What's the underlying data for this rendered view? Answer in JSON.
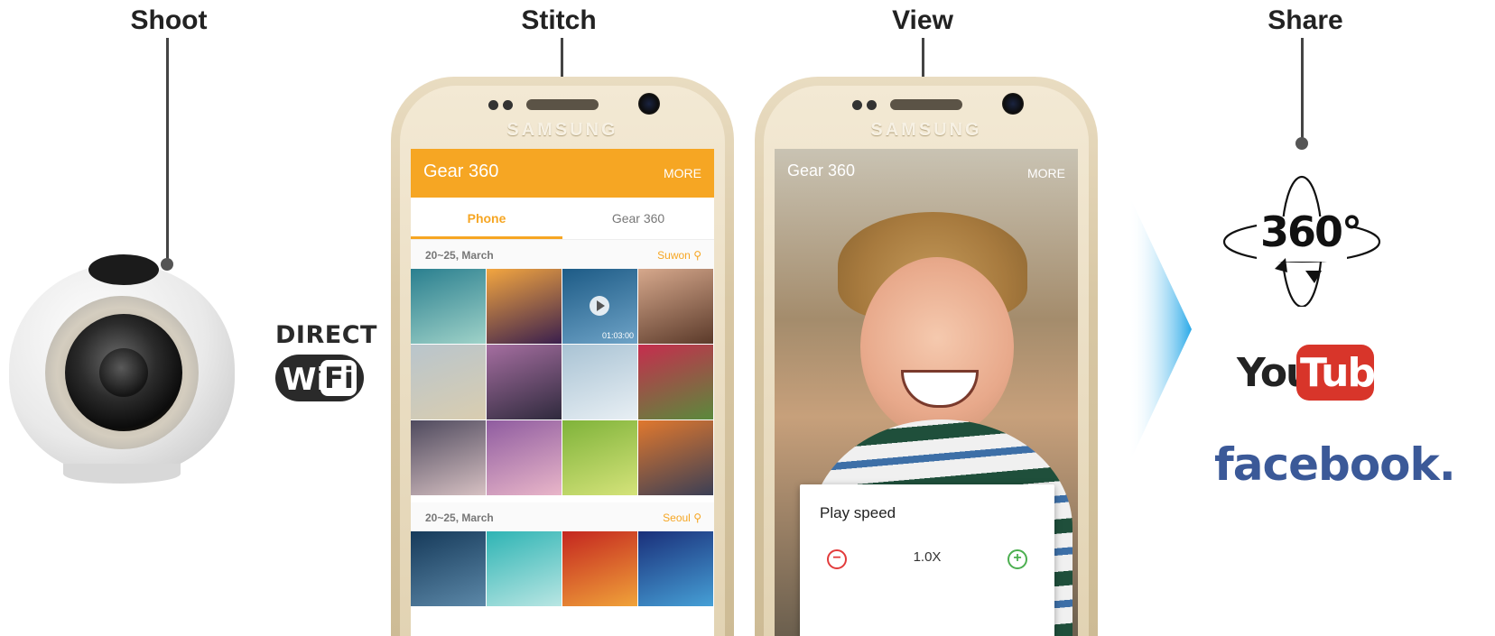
{
  "stages": {
    "shoot": "Shoot",
    "stitch": "Stitch",
    "view": "View",
    "share": "Share"
  },
  "connectivity": {
    "direct_label": "DIRECT",
    "wi_label": "Wi",
    "fi_label": "Fi"
  },
  "phone_brand": "SAMSUNG",
  "gallery_app": {
    "title": "Gear 360",
    "more_label": "MORE",
    "tabs": [
      {
        "label": "Phone",
        "active": true
      },
      {
        "label": "Gear 360",
        "active": false
      }
    ],
    "sections": [
      {
        "date": "20~25, March",
        "location": "Suwon",
        "thumbnails": [
          {
            "subject": "ocean-water",
            "color1": "#2a7f8f",
            "color2": "#9fd2c8"
          },
          {
            "subject": "pier-sunset",
            "color1": "#f3a640",
            "color2": "#3a1f4d"
          },
          {
            "subject": "raindrops-video",
            "color1": "#1d5b86",
            "color2": "#6ea3c7",
            "video": true,
            "duration": "01:03:00"
          },
          {
            "subject": "woman-portrait",
            "color1": "#d6a88c",
            "color2": "#5b3a2a"
          },
          {
            "subject": "beach-horizon",
            "color1": "#b9c5cc",
            "color2": "#d9cdb0"
          },
          {
            "subject": "yoga-sunset",
            "color1": "#a56ea0",
            "color2": "#2f2a3d"
          },
          {
            "subject": "frost-pattern",
            "color1": "#a9c3d4",
            "color2": "#e8eff4"
          },
          {
            "subject": "pink-flower",
            "color1": "#c62d4e",
            "color2": "#5a8a3c"
          },
          {
            "subject": "mountain-sky",
            "color1": "#4f4a5e",
            "color2": "#d6c0c2"
          },
          {
            "subject": "purple-flowers",
            "color1": "#8f5ca0",
            "color2": "#e9b6c9"
          },
          {
            "subject": "green-blur",
            "color1": "#7fb33a",
            "color2": "#d5e37a"
          },
          {
            "subject": "sea-sunset",
            "color1": "#e0782e",
            "color2": "#3b3f55"
          }
        ]
      },
      {
        "date": "20~25, March",
        "location": "Seoul",
        "thumbnails": [
          {
            "subject": "blue-drops",
            "color1": "#163a5a",
            "color2": "#5c88a8"
          },
          {
            "subject": "teal-waves",
            "color1": "#2eb4b4",
            "color2": "#b9e6e3"
          },
          {
            "subject": "red-abstract",
            "color1": "#c4261f",
            "color2": "#f0a33a"
          },
          {
            "subject": "blue-abstract",
            "color1": "#1a2f7a",
            "color2": "#46a0d6"
          }
        ]
      }
    ]
  },
  "viewer_app": {
    "title": "Gear 360",
    "more_label": "MORE",
    "dialog": {
      "title": "Play speed",
      "value": "1.0X",
      "minus_glyph": "−",
      "plus_glyph": "+"
    }
  },
  "share_targets": {
    "logo_360": "360°",
    "youtube_you": "You",
    "youtube_tube": "Tube",
    "facebook": "facebook."
  },
  "colors": {
    "accent_orange": "#f6a623",
    "arrow_blue": "#29a9e8",
    "youtube_red": "#d8352a",
    "facebook_blue": "#3b5998"
  }
}
